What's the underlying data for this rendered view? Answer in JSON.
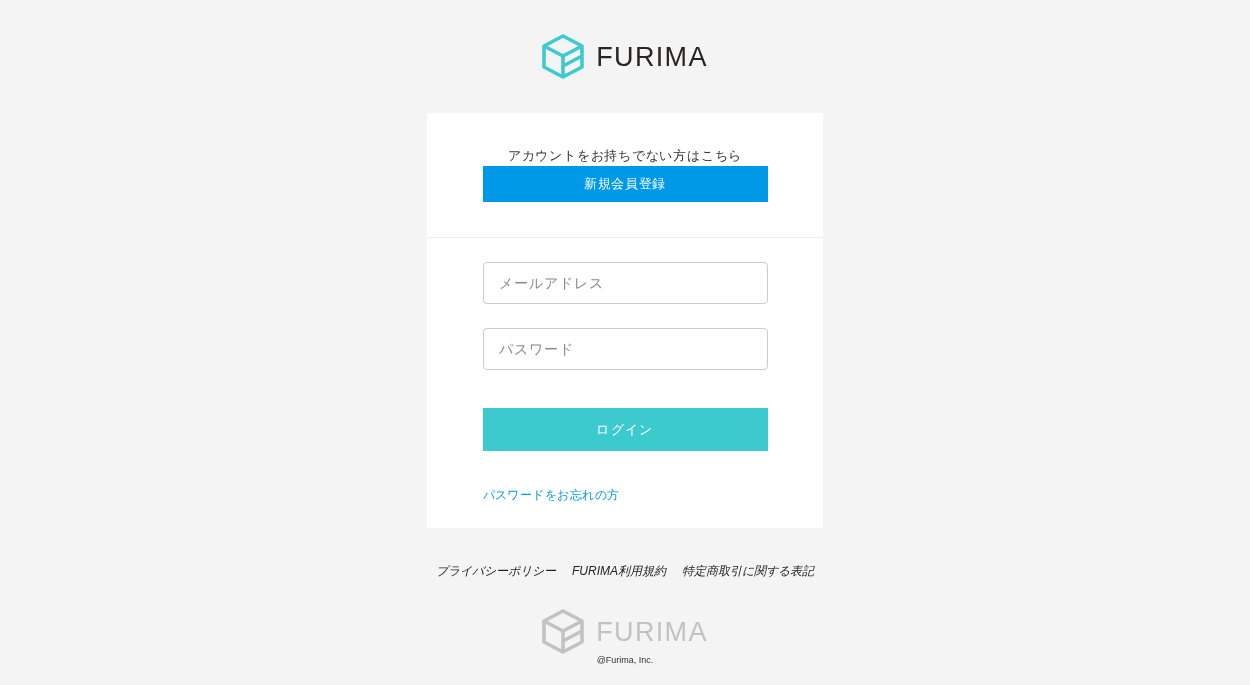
{
  "header": {
    "logo": {
      "text": "FURIMA"
    }
  },
  "signup": {
    "prompt": "アカウントをお持ちでない方はこちら",
    "button": "新規会員登録"
  },
  "login_form": {
    "fields": [
      {
        "placeholder": "メールアドレス"
      },
      {
        "placeholder": "パスワード"
      }
    ],
    "button": "ログイン",
    "forgot_link": "パスワードをお忘れの方"
  },
  "footer": {
    "links": [
      "プライバシーポリシー",
      "FURIMA利用規約",
      "特定商取引に関する表記"
    ],
    "logo": {
      "text": "FURIMA"
    },
    "copyright": "@Furima, Inc."
  }
}
